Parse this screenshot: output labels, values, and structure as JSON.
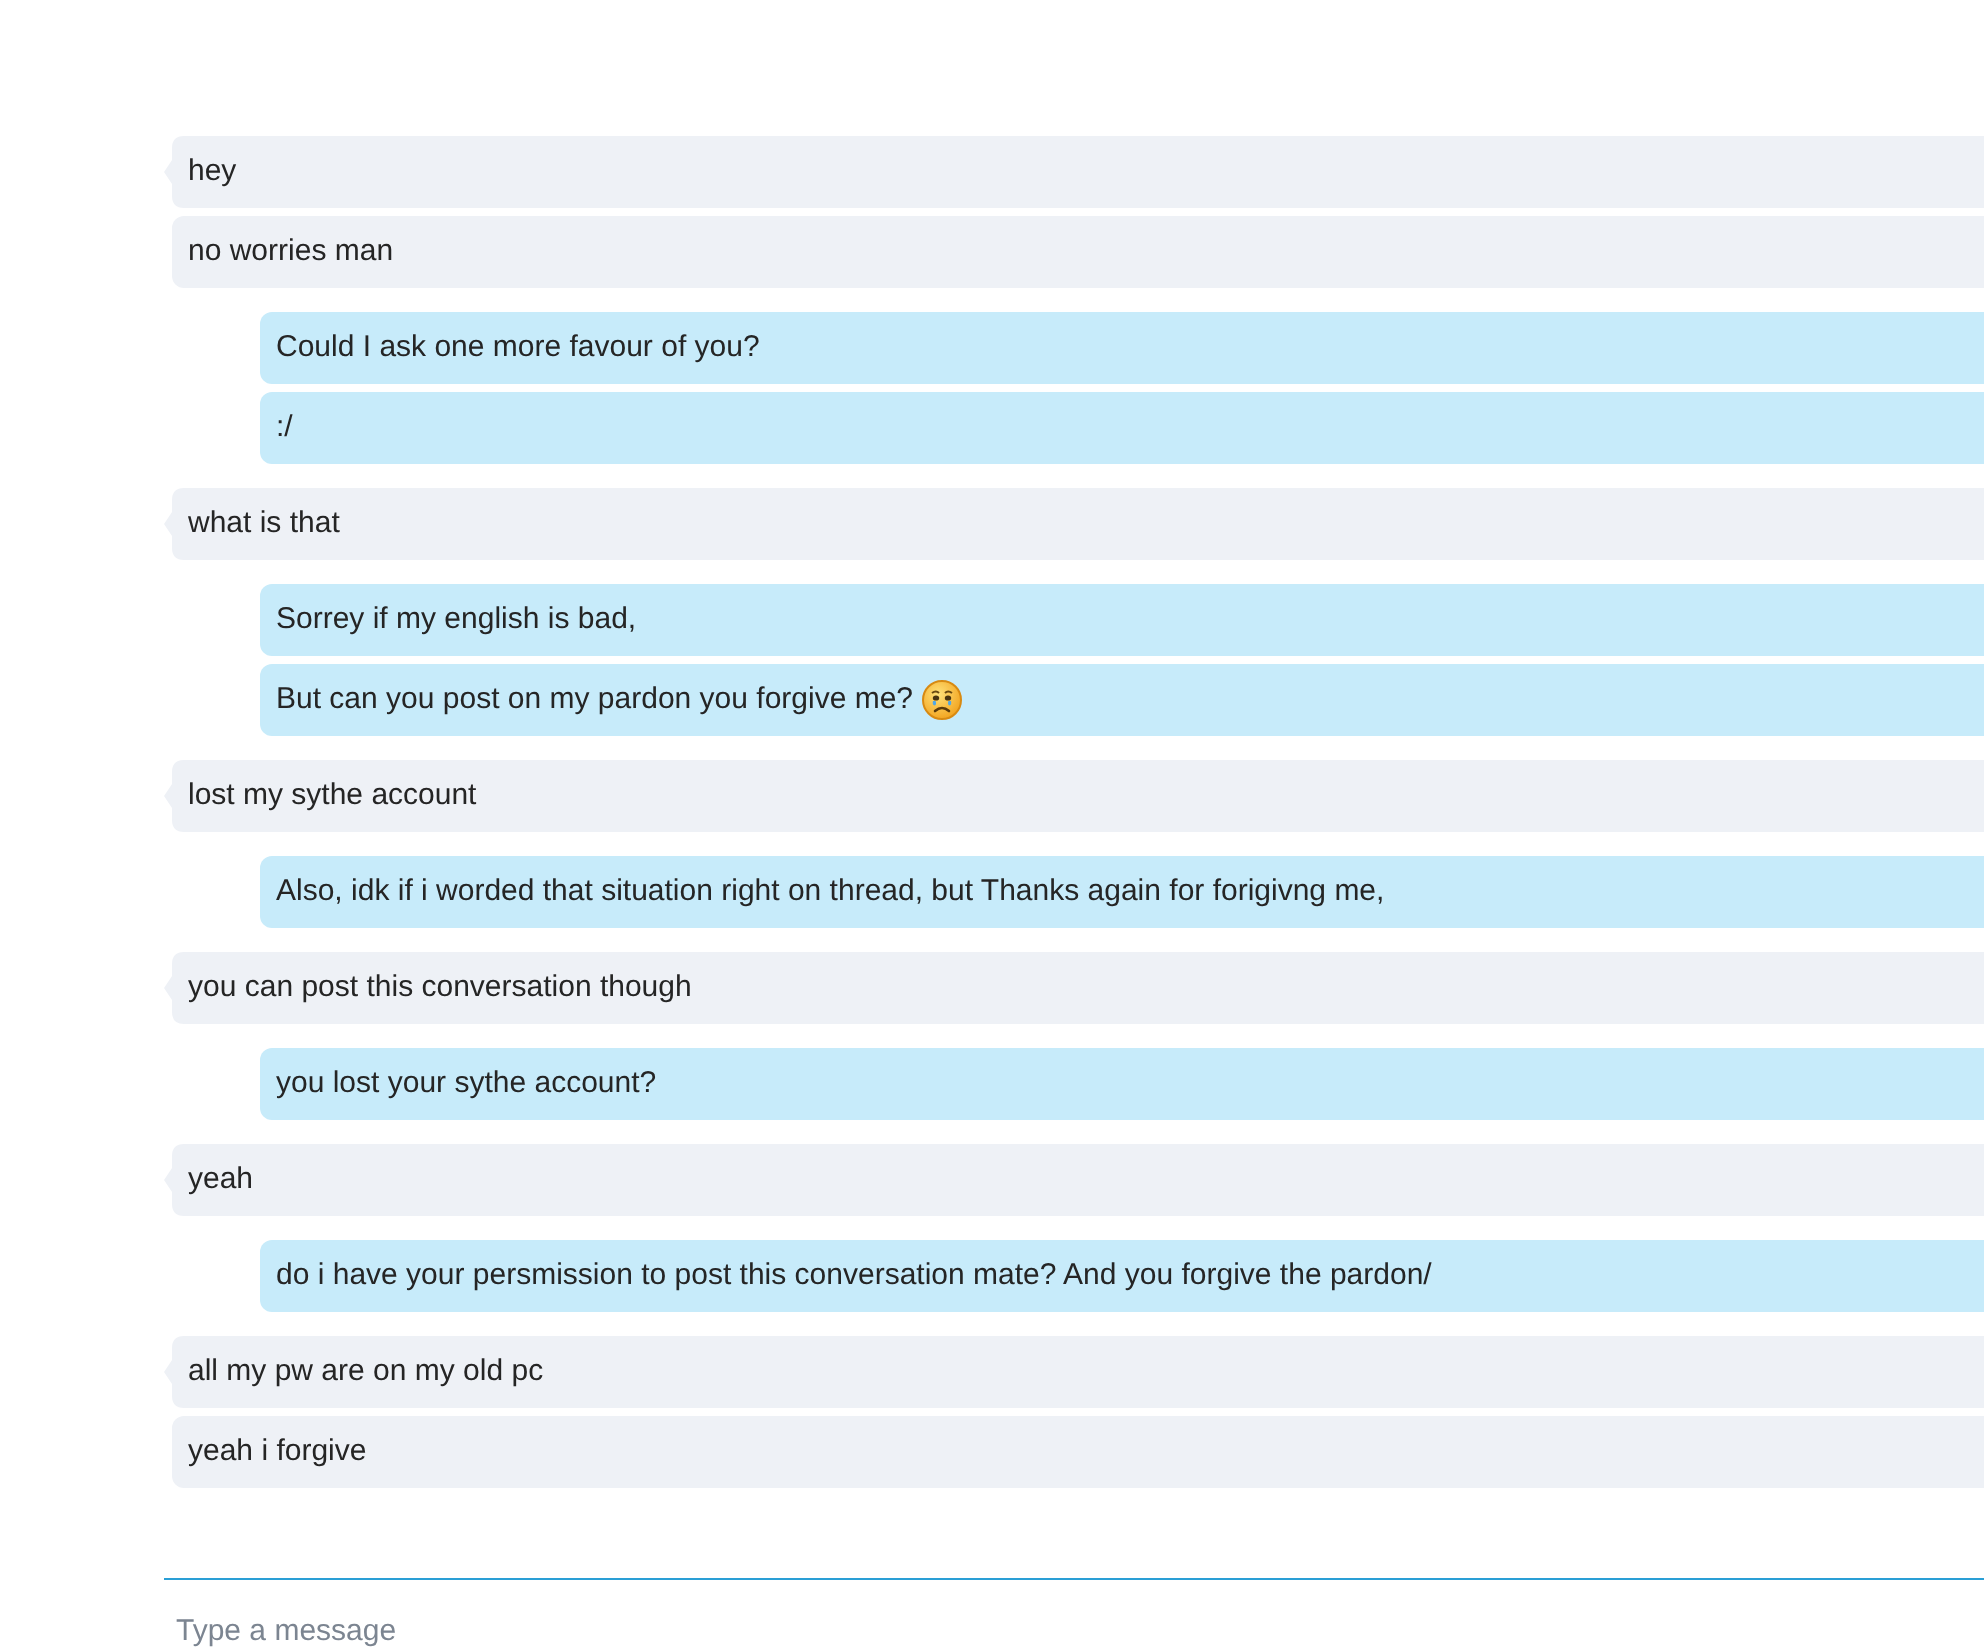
{
  "conversation": [
    {
      "kind": "received",
      "bubbles": [
        {
          "text": "hey",
          "emoji": false
        },
        {
          "text": "no worries man",
          "emoji": false
        }
      ]
    },
    {
      "kind": "sent",
      "bubbles": [
        {
          "text": "Could I ask one more favour of you?",
          "emoji": false
        },
        {
          "text": ":/",
          "emoji": false
        }
      ]
    },
    {
      "kind": "received",
      "bubbles": [
        {
          "text": "what is that",
          "emoji": false
        }
      ]
    },
    {
      "kind": "sent",
      "bubbles": [
        {
          "text": "Sorrey if my english is bad,",
          "emoji": false
        },
        {
          "text": "But can you post on my pardon you forgive me?",
          "emoji": true
        }
      ]
    },
    {
      "kind": "received",
      "bubbles": [
        {
          "text": "lost my sythe account",
          "emoji": false
        }
      ]
    },
    {
      "kind": "sent",
      "bubbles": [
        {
          "text": "Also, idk if i worded that situation right on thread, but Thanks again for forigivng me,",
          "emoji": false
        }
      ]
    },
    {
      "kind": "received",
      "bubbles": [
        {
          "text": "you can post this conversation though",
          "emoji": false
        }
      ]
    },
    {
      "kind": "sent",
      "bubbles": [
        {
          "text": "you lost your sythe account?",
          "emoji": false
        }
      ]
    },
    {
      "kind": "received",
      "bubbles": [
        {
          "text": "yeah",
          "emoji": false
        }
      ]
    },
    {
      "kind": "sent",
      "bubbles": [
        {
          "text": "do i have your persmission to post this conversation mate? And you forgive the pardon/",
          "emoji": false
        }
      ]
    },
    {
      "kind": "received",
      "bubbles": [
        {
          "text": "all my pw are on my old pc",
          "emoji": false
        },
        {
          "text": "yeah i forgive",
          "emoji": false
        }
      ]
    }
  ],
  "composer": {
    "placeholder": "Type a message"
  }
}
